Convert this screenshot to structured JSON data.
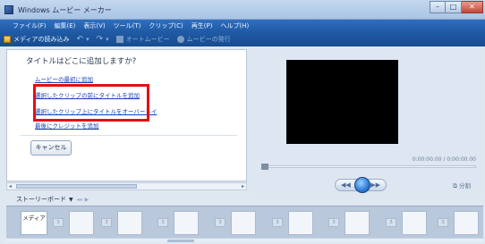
{
  "window": {
    "title": "Windows ムービー メーカー"
  },
  "menu": [
    "ファイル(F)",
    "編集(E)",
    "表示(V)",
    "ツール(T)",
    "クリップ(C)",
    "再生(P)",
    "ヘルプ(H)"
  ],
  "toolbar": {
    "import_label": "メディアの読み込み",
    "automovie_label": "オートムービー",
    "publish_label": "ムービーの発行"
  },
  "task_pane": {
    "heading": "タイトルはどこに追加しますか?",
    "options": [
      "ムービーの最初に追加",
      "選択したクリップの前にタイトルを追加",
      "選択したクリップ上にタイトルをオーバーレイ",
      "最後にクレジットを追加"
    ],
    "cancel_label": "キャンセル"
  },
  "preview": {
    "timecode": "0:00:00.00 / 0:00:00.00",
    "split_label": "分割"
  },
  "storyboard": {
    "label": "ストーリーボード",
    "first_item": "メディア",
    "transition_mark": "3"
  },
  "colors": {
    "highlight": "#e30f12",
    "menubar": "#2f6fbf",
    "link": "#1a3fb4"
  }
}
